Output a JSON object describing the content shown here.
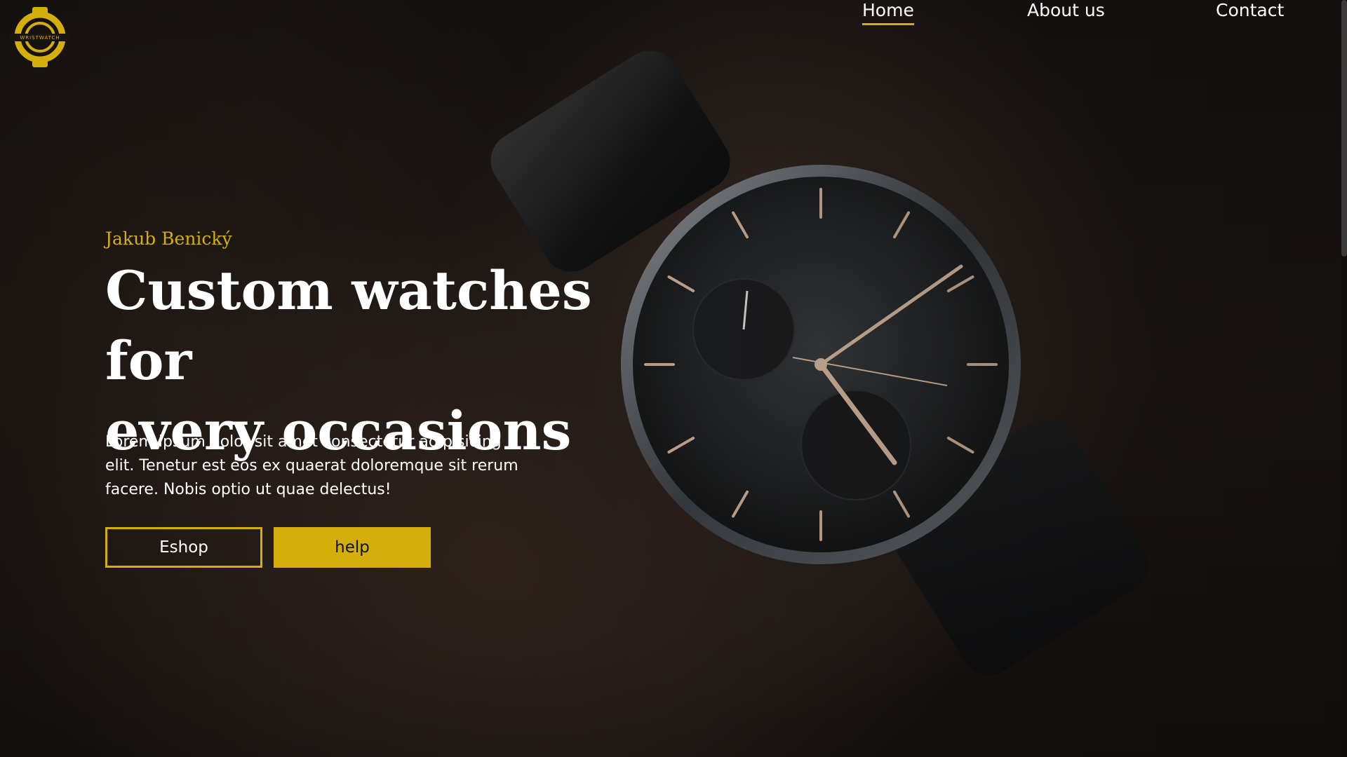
{
  "brand": {
    "logo_icon": "wristwatch-logo-icon",
    "logo_text": "WRISTWATCH",
    "accent_color": "#d4af0c"
  },
  "nav": {
    "items": [
      {
        "label": "Home",
        "active": true
      },
      {
        "label": "About us",
        "active": false
      },
      {
        "label": "Contact",
        "active": false
      }
    ]
  },
  "hero": {
    "author": "Jakub Benický",
    "headline_line1": "Custom watches for",
    "headline_line2": "every occasions",
    "description": "Lorem ipsum dolor sit amet consectetur adipisicing elit. Tenetur est eos ex quaerat doloremque sit rerum facere. Nobis optio ut quae delectus!",
    "buttons": {
      "eshop_label": "Eshop",
      "help_label": "help"
    },
    "background_image": "wristwatch-photo"
  }
}
